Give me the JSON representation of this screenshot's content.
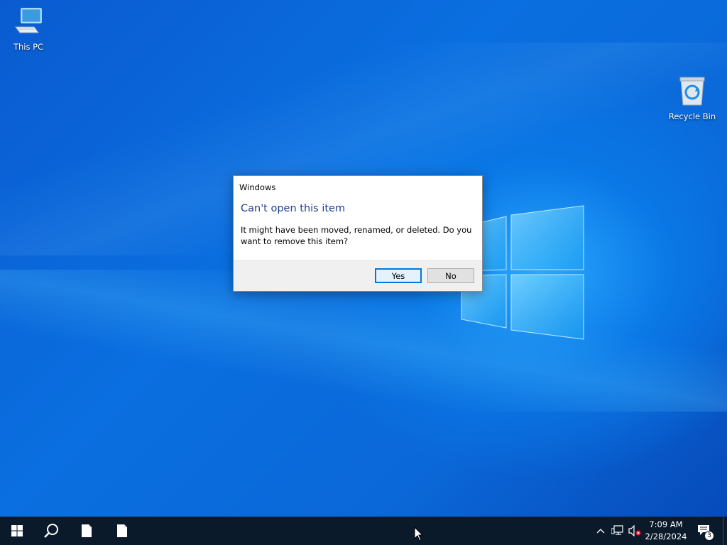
{
  "desktop": {
    "icons": [
      {
        "label": "This PC",
        "icon": "computer-icon"
      },
      {
        "label": "Recycle Bin",
        "icon": "recycle-bin-icon"
      }
    ]
  },
  "dialog": {
    "title": "Windows",
    "heading": "Can't open this item",
    "message": "It might have been moved, renamed, or deleted. Do you want to remove this item?",
    "yes_label": "Yes",
    "no_label": "No",
    "heading_color": "#1e3f8f",
    "accent_color": "#0078d7"
  },
  "taskbar": {
    "items": [
      {
        "name": "start",
        "icon": "windows-logo-icon"
      },
      {
        "name": "search",
        "icon": "search-icon"
      },
      {
        "name": "file",
        "icon": "document-icon"
      },
      {
        "name": "file",
        "icon": "document-icon"
      }
    ],
    "tray": {
      "icons": [
        "chevron-up-icon",
        "network-icon",
        "volume-muted-icon"
      ],
      "time": "7:09 AM",
      "date": "2/28/2024",
      "notification_count": "3"
    }
  }
}
